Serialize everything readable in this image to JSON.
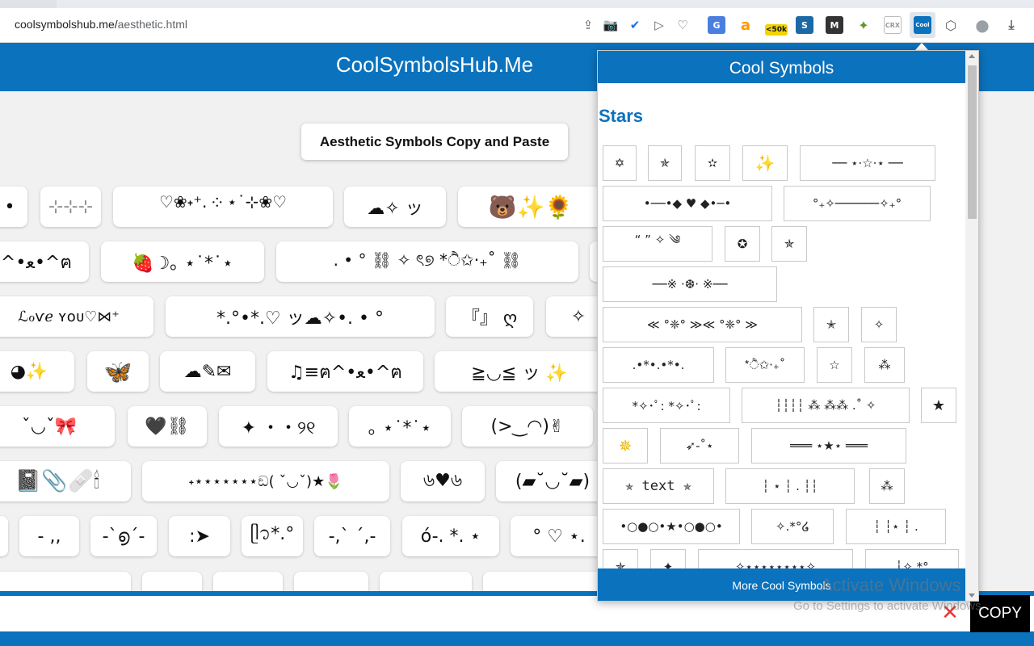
{
  "browser": {
    "url_host": "coolsymbolshub.me/",
    "url_path": "aesthetic.html",
    "toolbar_icons": [
      {
        "name": "share-icon",
        "glyph": "⇪"
      },
      {
        "name": "camera-icon",
        "glyph": "📷"
      },
      {
        "name": "shield-icon",
        "glyph": "✔"
      },
      {
        "name": "send-icon",
        "glyph": "▷"
      },
      {
        "name": "heart-icon",
        "glyph": "♡"
      }
    ],
    "extensions": [
      {
        "name": "translate-extension-icon",
        "glyph": "G",
        "bg": "#4a7fe0"
      },
      {
        "name": "amazon-extension-icon",
        "glyph": "a",
        "bg": "#ffffff",
        "fg": "#ff9900"
      },
      {
        "name": "ranking-extension-icon",
        "glyph": "<50k",
        "bg": "#f2d400",
        "fg": "#111111"
      },
      {
        "name": "s-extension-icon",
        "glyph": "S",
        "bg": "#1b6aa5"
      },
      {
        "name": "m-extension-icon",
        "glyph": "M",
        "bg": "#333333"
      },
      {
        "name": "puzzle-extension-icon",
        "glyph": "✦",
        "bg": "#ffffff",
        "fg": "#5a9a2a"
      },
      {
        "name": "crx-extension-icon",
        "glyph": "CRX",
        "bg": "#ffffff",
        "fg": "#999999"
      },
      {
        "name": "cool-symbols-extension-icon",
        "glyph": "Cool",
        "bg": "#0b72bd"
      },
      {
        "name": "box-icon",
        "glyph": "⬡",
        "bg": "#ffffff",
        "fg": "#5f6368"
      },
      {
        "name": "profile-avatar-icon",
        "glyph": "●",
        "bg": "#ffffff",
        "fg": "#9aa0a6"
      },
      {
        "name": "download-icon",
        "glyph": "⤓",
        "bg": "#ffffff",
        "fg": "#5f6368"
      }
    ]
  },
  "site": {
    "title": "CoolSymbolsHub.Me",
    "heading": "Aesthetic Symbols Copy and Paste",
    "symbols": [
      "•",
      "⊹⊹⊹",
      "♡❀˖⁺. ༶ ⋆˙⊹❀♡",
      "☁✧ ッ",
      "🐻✨🌻",
      "^•ﻌ•^ฅ",
      "🍓☽｡ ⋆˙*˙⋆",
      ". • ° ⛓ ✧ ৎ୭ *ੈ✩‧₊˚ ⛓",
      "",
      "ℒℴѵℯ ʏᴏᴜ♡⋈⁺",
      "*.°•*.♡ ッ☁✧•. • °",
      "『』 ღ",
      "✧",
      "◕✨",
      "🦋",
      "☁✎✉",
      "♫≡ฅ^•ﻌ•^ฅ",
      "≧◡≦ ッ ✨",
      "ˇ◡ˇ🎀",
      "🖤⛓",
      "✦ ・・୨୧",
      "｡ ⋆˙*˙⋆",
      "(>‿◠)✌",
      "📓📎🩹🕯",
      "˖⋆⋆⋆⋆⋆⋆⋆ඞ( ˇ◡ˇ)★🌷",
      "৬♥৬",
      "(▰˘◡˘▰)",
      "˙",
      "- ,,",
      "-`൭´-",
      ":➤",
      "ᥫ᭡*.°",
      "-,ˋ ˊ,-",
      "ó-. *. ⋆",
      "° ♡ ⋆."
    ]
  },
  "popup": {
    "header": "Cool Symbols",
    "section_title": "Stars",
    "footer_link": "More Cool Symbols",
    "buttons": [
      "✡",
      "✯",
      "✫",
      "✨",
      "── ⋆⋅☆⋅⋆ ──",
      "•──•◆ ♥ ◆•─•",
      "°₊✧──────✧₊°",
      "“ ” ✧ ༄",
      "✪",
      "✯",
      "──※ ·❆· ※──",
      "≪ °❈° ≫≪ °❈° ≫",
      "✭",
      "✧",
      ".•*•.•*•.",
      "*ੈ✩‧₊˚",
      "☆",
      "⁂",
      "*✧･ﾟ: *✧･ﾟ:",
      "┆┆┆┆ ⁂ ⁂⁂ .˚ ✧",
      "★",
      "✵",
      "➶-˚⋆",
      "═══ ⋆★⋆ ═══",
      "✯ text ✯",
      "┆ ⋆ ┆ . ┆┆",
      "⁂",
      "•○●○•★•○●○•",
      "✧.*°໒",
      "┆ ┆⋆ ┆ .",
      "✯",
      "✦",
      "✧⋆⋆⋆⋆⋆⋆⋆⋆✧",
      "┆✧.*°"
    ]
  },
  "copy_bar": {
    "close_glyph": "✕",
    "copy_label": "COPY"
  },
  "watermark": {
    "title": "Activate Windows",
    "subtitle": "Go to Settings to activate Windows."
  }
}
